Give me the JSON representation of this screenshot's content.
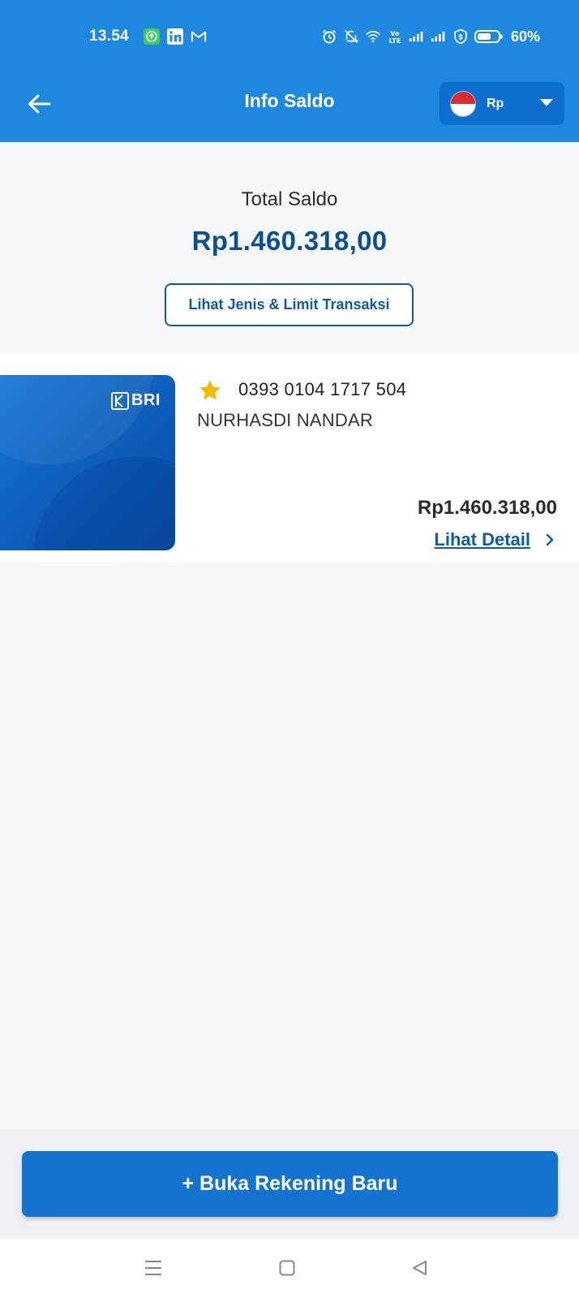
{
  "status_bar": {
    "time": "13.54",
    "battery_text": "60%",
    "notification_icons": [
      "upload-icon",
      "linkedin-icon",
      "gmail-icon"
    ],
    "system_icons": [
      "alarm-icon",
      "mute-icon",
      "wifi-icon",
      "volte-icon",
      "signal-icon",
      "signal-icon",
      "vpn-shield-icon",
      "battery-icon"
    ]
  },
  "header": {
    "title": "Info Saldo",
    "back_icon": "arrow-left-icon",
    "currency": {
      "label": "Rp",
      "flag": "indonesia-flag",
      "caret": "caret-down-icon"
    }
  },
  "summary": {
    "total_label": "Total Saldo",
    "total_amount": "Rp1.460.318,00",
    "limit_button_label": "Lihat Jenis & Limit Transaksi"
  },
  "account": {
    "bank_logo_text": "BRI",
    "favorite_icon": "star-icon",
    "number": "0393 0104 1717 504",
    "holder_name": "NURHASDI NANDAR",
    "balance": "Rp1.460.318,00",
    "detail_link": "Lihat Detail"
  },
  "footer": {
    "new_account_button": "+ Buka Rekening Baru"
  },
  "nav_bar": {
    "buttons": [
      "menu-icon",
      "home-icon",
      "back-triangle-icon"
    ]
  },
  "colors": {
    "header_blue": "#1e88e0",
    "primary_dark_blue": "#0a4f93",
    "button_blue": "#1473cf",
    "star_gold": "#f5b800"
  }
}
